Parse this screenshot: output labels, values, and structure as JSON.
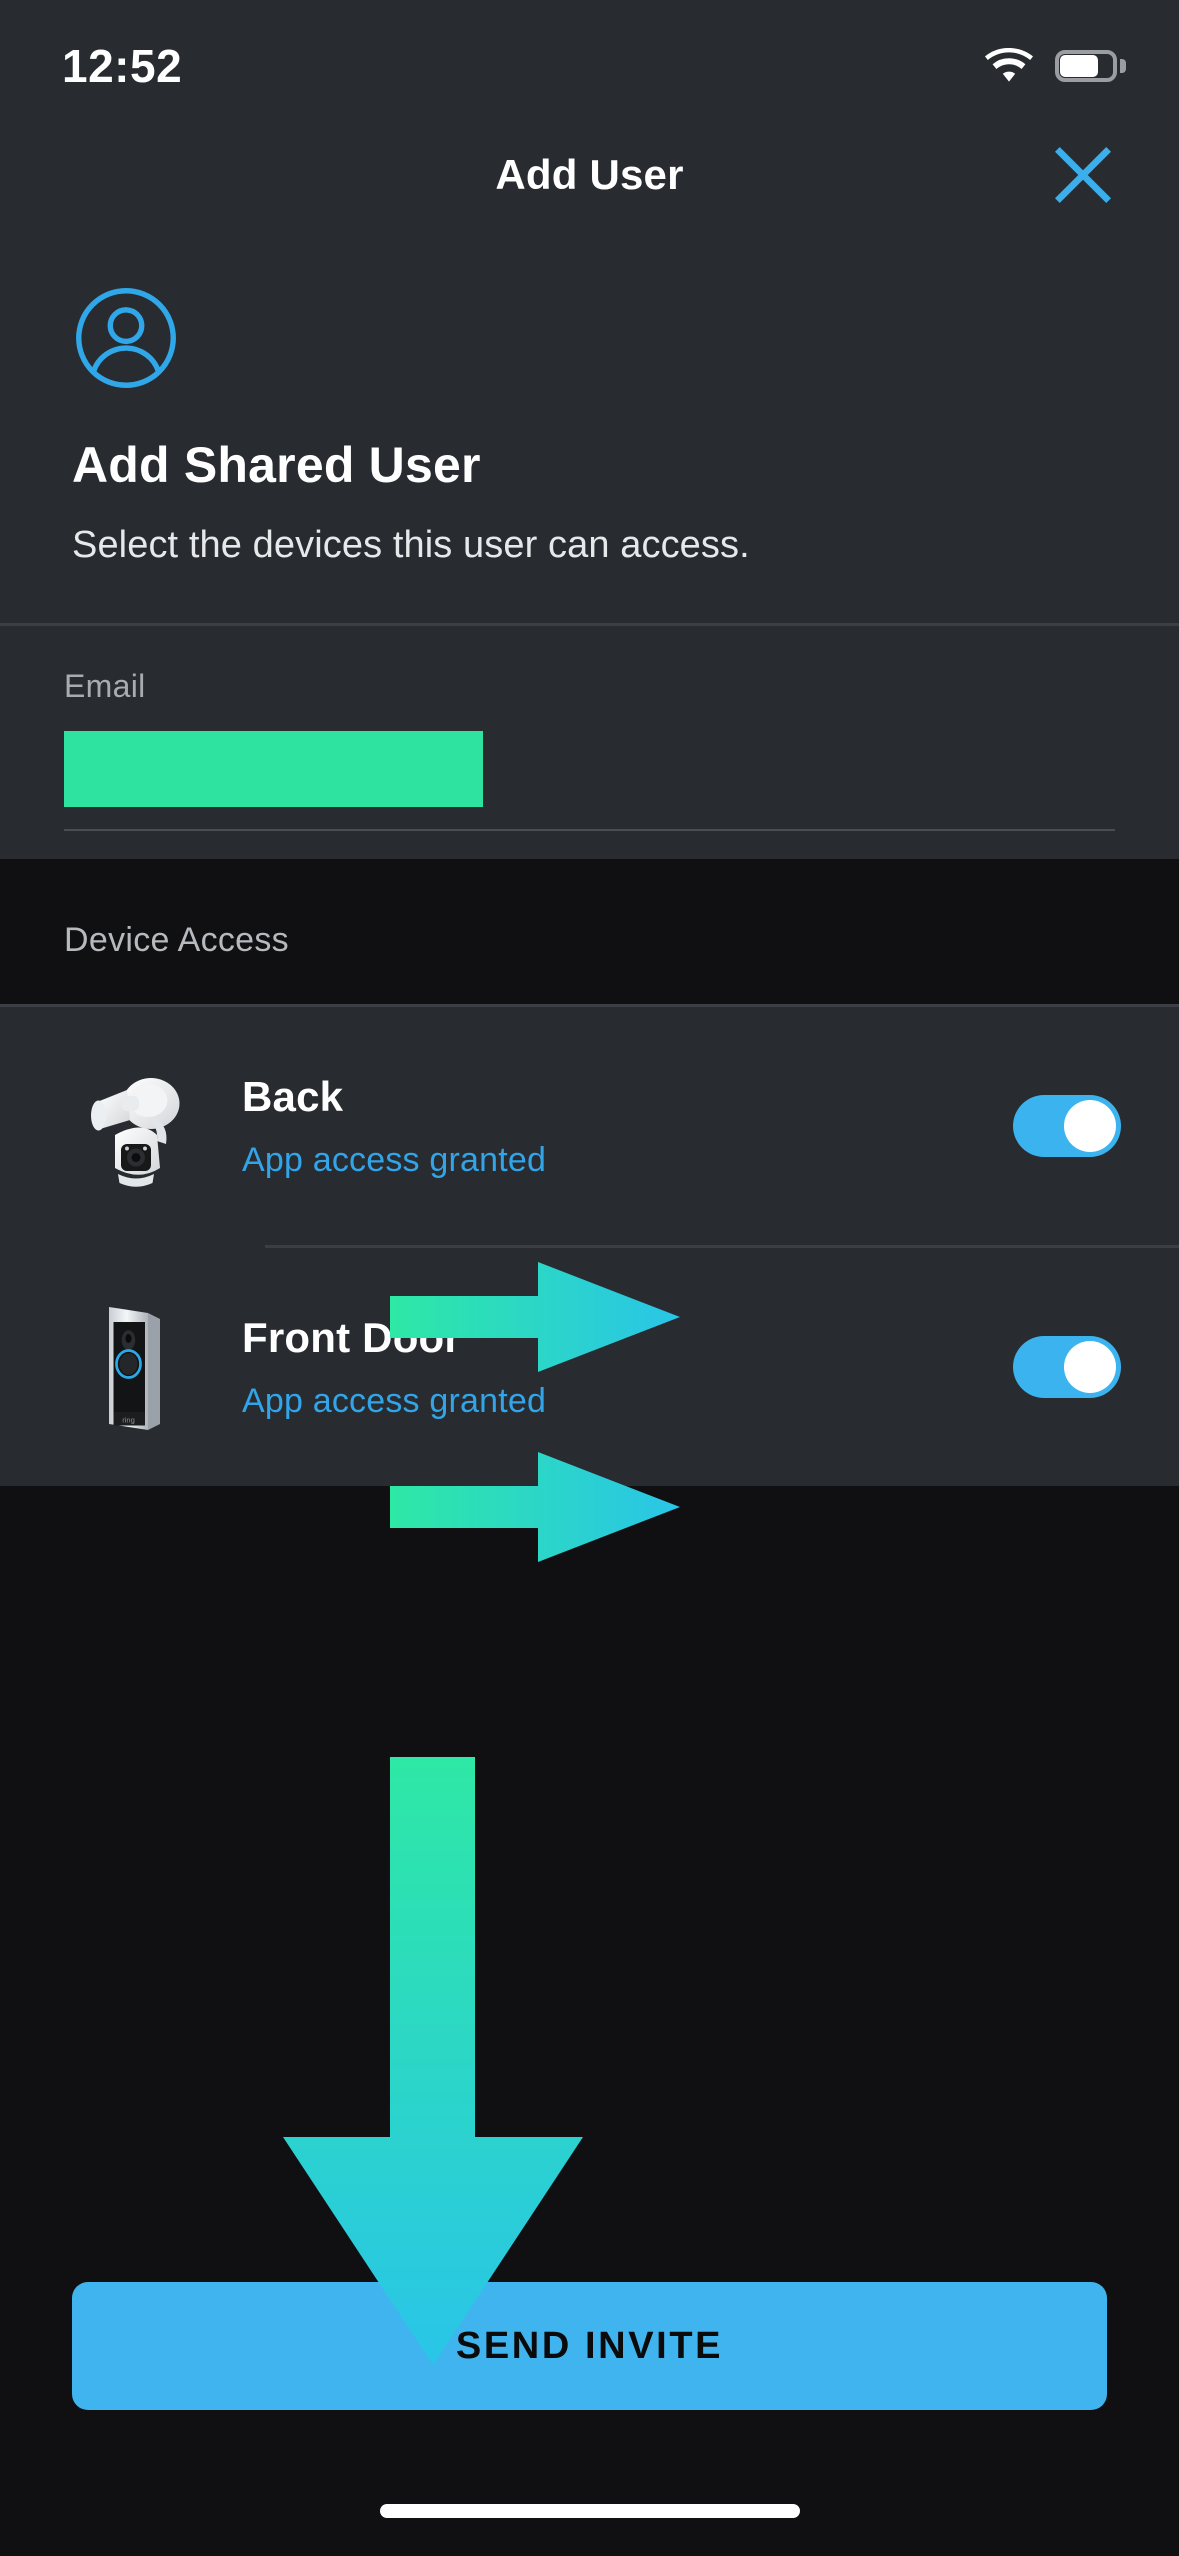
{
  "status_bar": {
    "time": "12:52",
    "wifi_icon": "wifi-icon",
    "battery_icon": "battery-icon",
    "battery_level_pct": 62
  },
  "nav": {
    "title": "Add User",
    "close_icon": "close-x-icon"
  },
  "hero": {
    "avatar_icon": "user-avatar-icon",
    "title": "Add Shared User",
    "subtitle": "Select the devices this user can access."
  },
  "email": {
    "label": "Email",
    "value": "",
    "placeholder": "",
    "redacted": true
  },
  "device_access": {
    "section_label": "Device Access",
    "devices": [
      {
        "name": "Back",
        "status": "App access granted",
        "thumb_icon": "floodlight-camera-icon",
        "toggle_on": true
      },
      {
        "name": "Front Door",
        "status": "App access granted",
        "thumb_icon": "video-doorbell-icon",
        "toggle_on": true
      }
    ]
  },
  "footer": {
    "send_invite_label": "SEND INVITE",
    "home_indicator": "home-indicator"
  },
  "annotations": {
    "arrow_back_toggle": "right-arrow-pointing-to-back-toggle",
    "arrow_front_toggle": "right-arrow-pointing-to-front-door-toggle",
    "arrow_send_invite": "down-arrow-pointing-to-send-invite"
  },
  "colors": {
    "accent_blue": "#40B4EF",
    "status_blue": "#32A4E8",
    "arrow_green": "#2EE8A5",
    "arrow_cyan": "#29C5E8",
    "redaction_green": "#2EE2A0",
    "panel_bg": "#282B30",
    "page_bg": "#101012"
  }
}
